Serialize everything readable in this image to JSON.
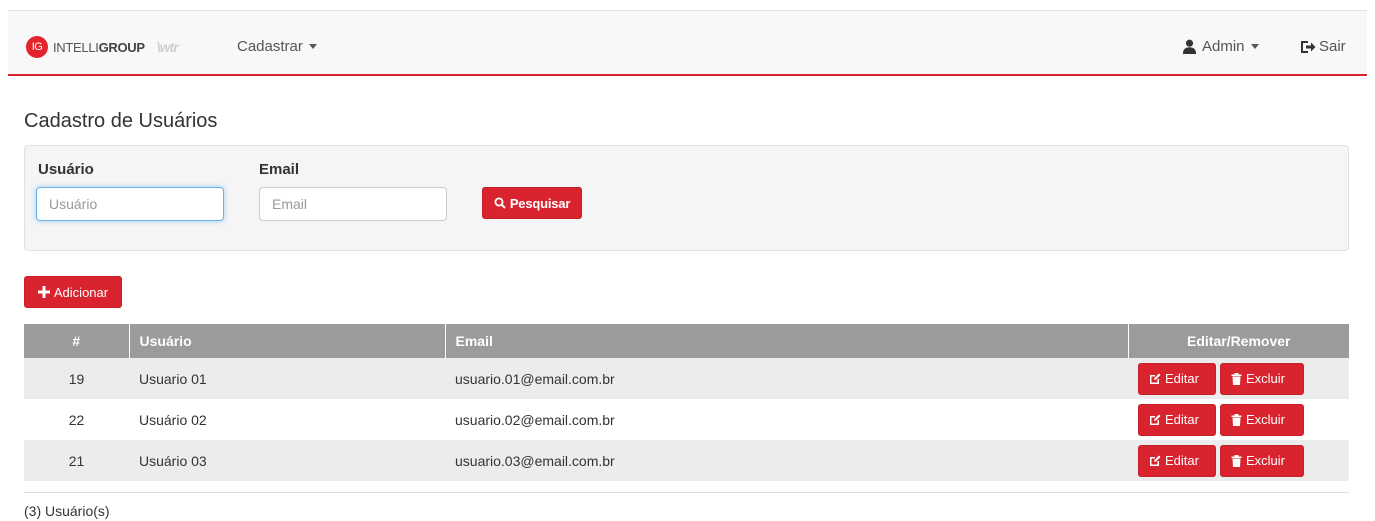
{
  "navbar": {
    "brand_mark": "IG",
    "brand_text_light": "INTELLI",
    "brand_text_bold": "GROUP",
    "brand_sub": "\\wtr",
    "menu_cadastrar": "Cadastrar",
    "user_menu": "Admin",
    "logout": "Sair"
  },
  "page": {
    "title": "Cadastro de Usuários"
  },
  "filters": {
    "user_label": "Usuário",
    "user_placeholder": "Usuário",
    "user_value": "",
    "email_label": "Email",
    "email_placeholder": "Email",
    "email_value": "",
    "search_button": "Pesquisar"
  },
  "actions": {
    "add_button": "Adicionar"
  },
  "table": {
    "headers": [
      "#",
      "Usuário",
      "Email",
      "Editar/Remover"
    ],
    "rows": [
      {
        "id": "19",
        "user": "Usuario 01",
        "email": "usuario.01@email.com.br"
      },
      {
        "id": "22",
        "user": "Usuário 02",
        "email": "usuario.02@email.com.br"
      },
      {
        "id": "21",
        "user": "Usuário 03",
        "email": "usuario.03@email.com.br"
      }
    ],
    "edit_label": "Editar",
    "delete_label": "Excluir"
  },
  "footer": {
    "count_text": "(3) Usuário(s)"
  },
  "colors": {
    "accent": "#d9232e",
    "table_header": "#9b9b9b",
    "row_alt": "#ececec"
  },
  "icons": {
    "user_menu": "user-icon",
    "logout": "sign-out-icon",
    "search": "search-icon",
    "add": "plus-icon",
    "edit": "edit-icon",
    "delete": "trash-icon"
  }
}
